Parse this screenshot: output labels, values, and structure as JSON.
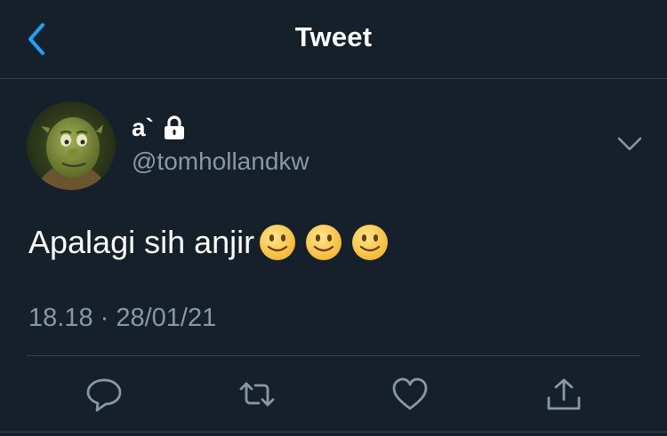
{
  "header": {
    "title": "Tweet",
    "back_icon": "chevron-left-icon"
  },
  "tweet": {
    "author": {
      "display_name": "a`",
      "handle": "@tomhollandkw",
      "protected_icon": "lock-icon",
      "avatar": "avatar"
    },
    "text": "Apalagi sih anjir",
    "emojis": [
      "slightly-smiling-face",
      "slightly-smiling-face",
      "slightly-smiling-face"
    ],
    "timestamp": "18.18 · 28/01/21",
    "more_icon": "chevron-down-icon"
  },
  "actions": [
    {
      "name": "reply",
      "icon": "reply-icon"
    },
    {
      "name": "retweet",
      "icon": "retweet-icon"
    },
    {
      "name": "like",
      "icon": "heart-icon"
    },
    {
      "name": "share",
      "icon": "share-icon"
    }
  ],
  "colors": {
    "background": "#15202b",
    "accent": "#1da1f2",
    "muted": "#8899a6",
    "divider": "#38444d"
  }
}
